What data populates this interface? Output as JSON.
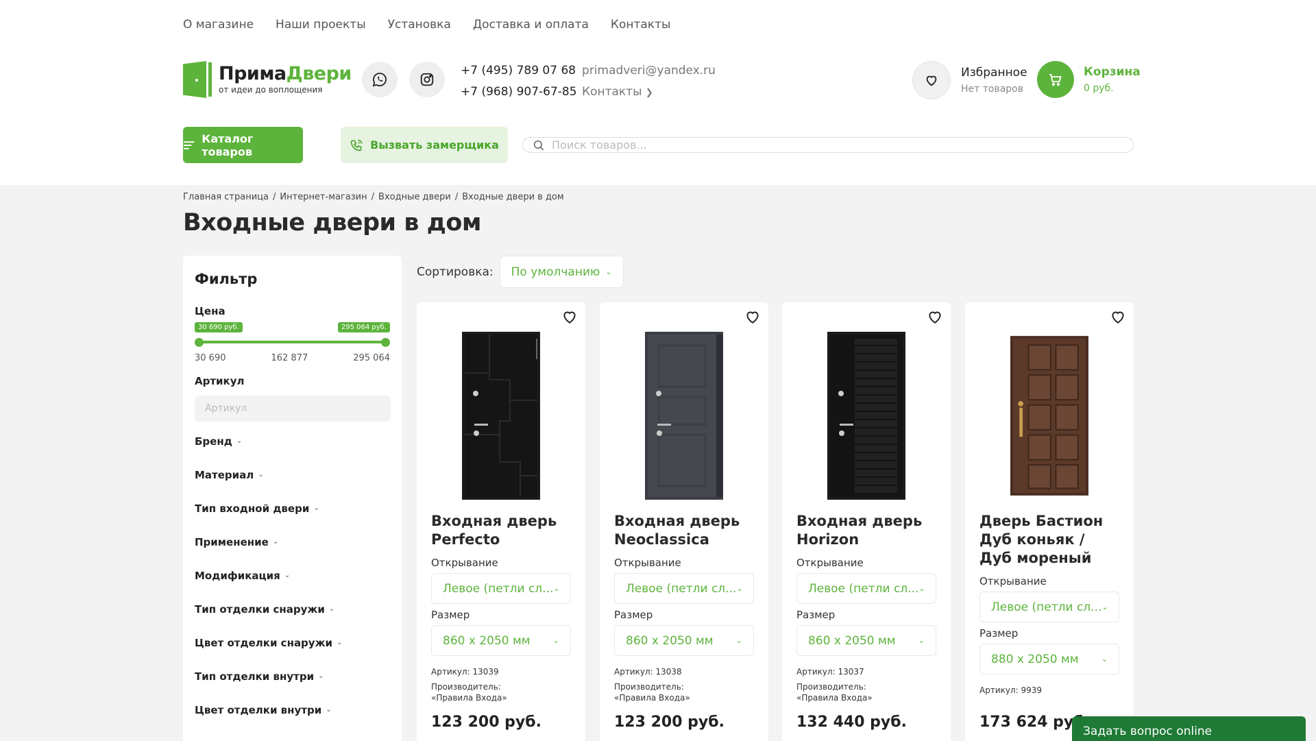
{
  "topnav": [
    "О магазине",
    "Наши проекты",
    "Установка",
    "Доставка и оплата",
    "Контакты"
  ],
  "logo": {
    "name_part1": "Прима",
    "name_part2": "Двери",
    "tagline": "от идеи до воплощения"
  },
  "contacts": {
    "phone1": "+7 (495) 789 07 68",
    "phone2": "+7 (968) 907-67-85",
    "email": "primadveri@yandex.ru",
    "contacts_link": "Контакты"
  },
  "favorites": {
    "label": "Избранное",
    "status": "Нет товаров"
  },
  "cart": {
    "label": "Корзина",
    "total": "0 руб."
  },
  "buttons": {
    "catalog": "Каталог товаров",
    "call_measurer": "Вызвать замерщика"
  },
  "search": {
    "placeholder": "Поиск товаров..."
  },
  "breadcrumbs": [
    "Главная страница",
    "Интернет-магазин",
    "Входные двери",
    "Входные двери в дом"
  ],
  "page_title": "Входные двери в дом",
  "filter": {
    "title": "Фильтр",
    "price_label": "Цена",
    "price_min_tag": "30 690 руб.",
    "price_max_tag": "295 064 руб.",
    "price_min": "30 690",
    "price_mid": "162 877",
    "price_max": "295 064",
    "article_label": "Артикул",
    "article_placeholder": "Артикул",
    "facets": [
      "Бренд",
      "Материал",
      "Тип входной двери",
      "Применение",
      "Модификация",
      "Тип отделки снаружи",
      "Цвет отделки снаружи",
      "Тип отделки внутри",
      "Цвет отделки внутри"
    ]
  },
  "sort": {
    "label": "Сортировка:",
    "value": "По умолчанию"
  },
  "products": [
    {
      "name": "Входная дверь Perfecto",
      "opening_label": "Открывание",
      "opening": "Левое (петли сл...",
      "size_label": "Размер",
      "size": "860 x 2050 мм",
      "article": "Артикул: 13039",
      "maker_label": "Производитель:",
      "maker": "«Правила Входа»",
      "price": "123 200 руб."
    },
    {
      "name": "Входная дверь Neoclassica",
      "opening_label": "Открывание",
      "opening": "Левое (петли сл...",
      "size_label": "Размер",
      "size": "860 x 2050 мм",
      "article": "Артикул: 13038",
      "maker_label": "Производитель:",
      "maker": "«Правила Входа»",
      "price": "123 200 руб."
    },
    {
      "name": "Входная дверь Horizon",
      "opening_label": "Открывание",
      "opening": "Левое (петли сл...",
      "size_label": "Размер",
      "size": "860 x 2050 мм",
      "article": "Артикул: 13037",
      "maker_label": "Производитель:",
      "maker": "«Правила Входа»",
      "price": "132 440 руб."
    },
    {
      "name": "Дверь Бастион Дуб коньяк / Дуб мореный",
      "opening_label": "Открывание",
      "opening": "Левое (петли сл...",
      "size_label": "Размер",
      "size": "880 x 2050 мм",
      "article": "Артикул: 9939",
      "price": "173 624 руб."
    }
  ],
  "chat": {
    "label": "Задать вопрос online"
  },
  "colors": {
    "accent": "#5db43c",
    "chat": "#1f7a35"
  }
}
